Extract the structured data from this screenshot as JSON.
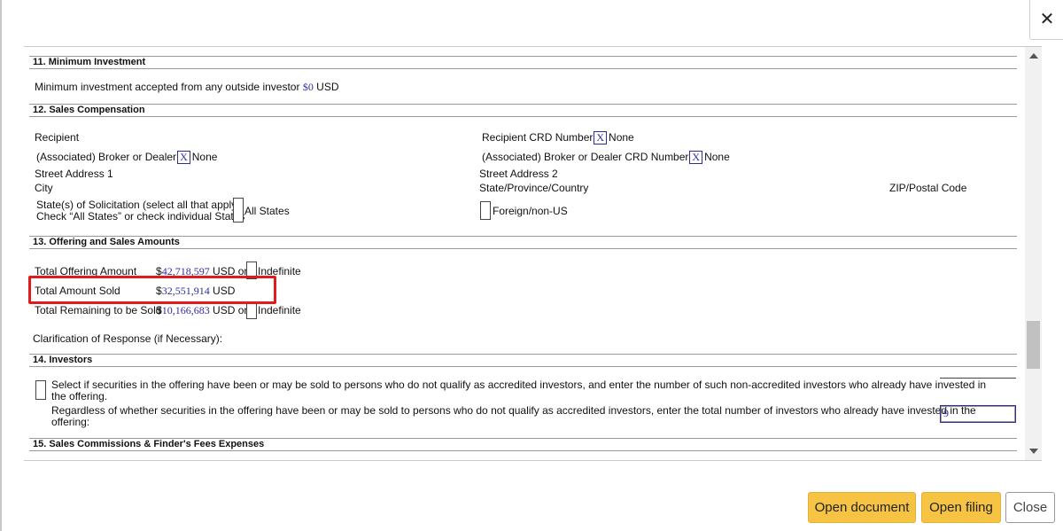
{
  "dialog": {
    "close_glyph": "✕",
    "buttons": {
      "open_document": "Open document",
      "open_filing": "Open filing",
      "close": "Close"
    }
  },
  "sections": {
    "s11": {
      "title": "11. Minimum Investment",
      "text": "Minimum investment accepted from any outside investor",
      "currency": "$",
      "value": "0",
      "unit": "USD"
    },
    "s12": {
      "title": "12. Sales Compensation",
      "recipient": "Recipient",
      "recipient_crd": "Recipient CRD Number",
      "broker": "(Associated) Broker or Dealer",
      "broker_crd": "(Associated) Broker or Dealer CRD Number",
      "x": "X",
      "none": "None",
      "street1": "Street Address 1",
      "street2": "Street Address 2",
      "city": "City",
      "state_province": "State/Province/Country",
      "zip": "ZIP/Postal Code",
      "solicitation_line1": "State(s) of Solicitation (select all that apply)",
      "solicitation_line2": "Check “All States” or check individual States",
      "all_states": "All States",
      "foreign": "Foreign/non-US"
    },
    "s13": {
      "title": "13. Offering and Sales Amounts",
      "total_offering_label": "Total Offering Amount",
      "total_offering_value": "42,718,597",
      "total_sold_label": "Total Amount Sold",
      "total_sold_value": "32,551,914",
      "remaining_label": "Total Remaining to be Sold",
      "remaining_value": "10,166,683",
      "currency": "$",
      "unit": "USD",
      "or": "or",
      "indefinite": "Indefinite",
      "clarification": "Clarification of Response (if Necessary):"
    },
    "s14": {
      "title": "14. Investors",
      "select_line1": "Select if securities in the offering have been or may be sold to persons who do not qualify as accredited investors, and enter the number of such non-accredited investors who already have invested in",
      "select_line2": "the offering.",
      "regardless_line1": "Regardless of whether securities in the offering have been or may be sold to persons who do not qualify as accredited investors, enter the total number of investors who already have invested in the",
      "regardless_line2": "offering:",
      "investor_count": "9"
    },
    "s15": {
      "title": "15. Sales Commissions & Finder's Fees Expenses"
    }
  }
}
